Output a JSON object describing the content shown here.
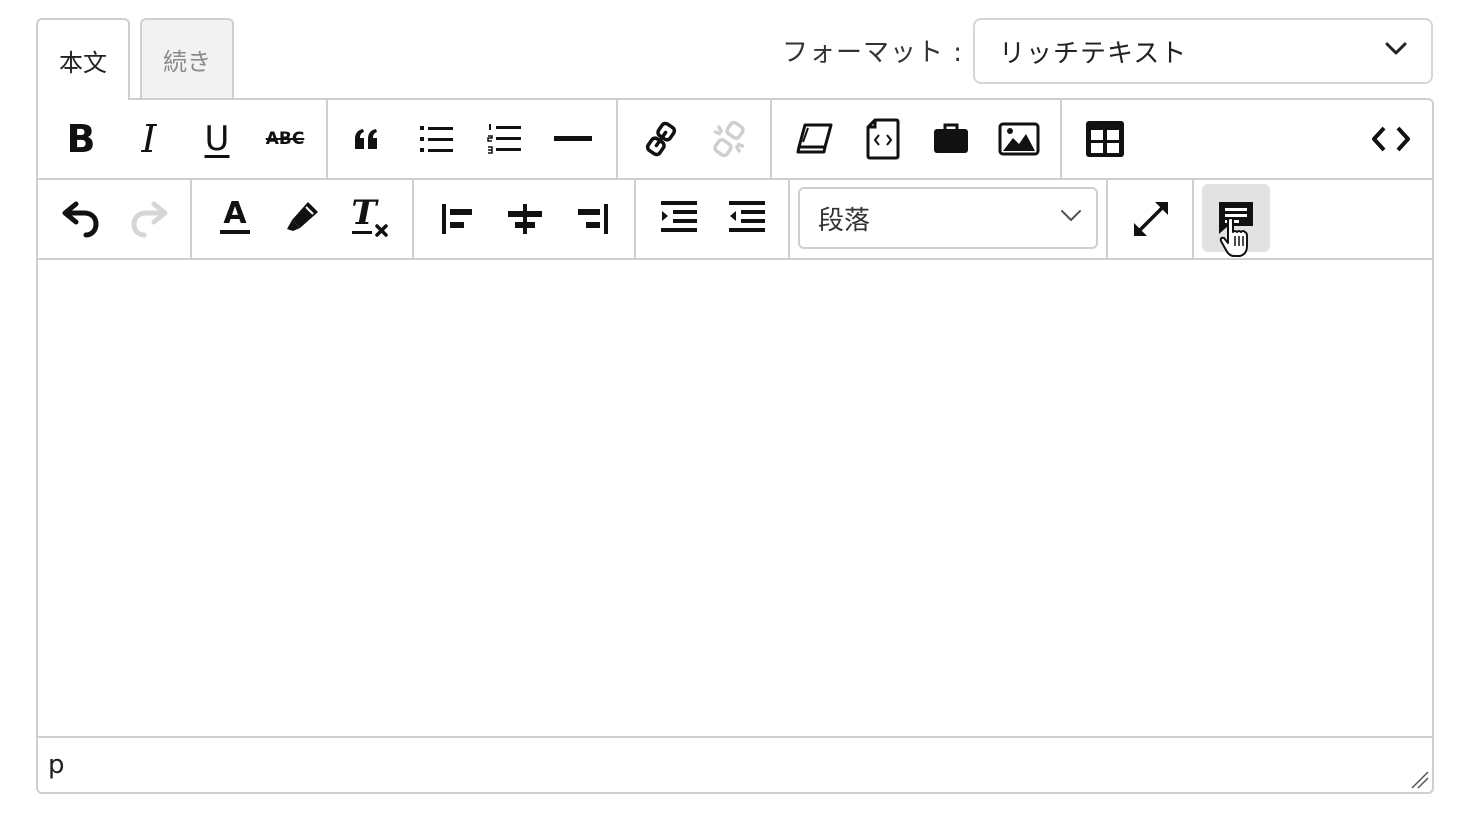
{
  "tabs": [
    {
      "label": "本文",
      "active": true
    },
    {
      "label": "続き",
      "active": false
    }
  ],
  "format": {
    "label": "フォーマット :",
    "selected": "リッチテキスト"
  },
  "toolbar": {
    "row1": [
      {
        "name": "bold-button",
        "icon": "bold-icon",
        "glyph": "B"
      },
      {
        "name": "italic-button",
        "icon": "italic-icon",
        "glyph": "I"
      },
      {
        "name": "underline-button",
        "icon": "underline-icon",
        "glyph": "U"
      },
      {
        "name": "strikethrough-button",
        "icon": "strikethrough-icon",
        "glyph": "ABC"
      },
      {
        "name": "blockquote-button",
        "icon": "quote-icon"
      },
      {
        "name": "bullet-list-button",
        "icon": "bullet-list-icon"
      },
      {
        "name": "numbered-list-button",
        "icon": "numbered-list-icon"
      },
      {
        "name": "horizontal-rule-button",
        "icon": "horizontal-rule-icon"
      },
      {
        "name": "link-button",
        "icon": "link-icon"
      },
      {
        "name": "unlink-button",
        "icon": "unlink-icon",
        "disabled": true
      },
      {
        "name": "template-button",
        "icon": "template-icon"
      },
      {
        "name": "code-file-button",
        "icon": "code-file-icon"
      },
      {
        "name": "media-button",
        "icon": "briefcase-icon"
      },
      {
        "name": "image-button",
        "icon": "image-icon"
      },
      {
        "name": "table-button",
        "icon": "table-icon"
      },
      {
        "name": "source-code-button",
        "icon": "code-icon"
      }
    ],
    "row2": [
      {
        "name": "undo-button",
        "icon": "undo-icon"
      },
      {
        "name": "redo-button",
        "icon": "redo-icon",
        "disabled": true
      },
      {
        "name": "text-color-button",
        "icon": "text-color-icon",
        "glyph": "A"
      },
      {
        "name": "highlight-button",
        "icon": "highlighter-icon"
      },
      {
        "name": "clear-format-button",
        "icon": "clear-format-icon",
        "glyph": "T"
      },
      {
        "name": "align-left-button",
        "icon": "align-left-icon"
      },
      {
        "name": "align-center-button",
        "icon": "align-center-icon"
      },
      {
        "name": "align-right-button",
        "icon": "align-right-icon"
      },
      {
        "name": "indent-button",
        "icon": "indent-icon"
      },
      {
        "name": "outdent-button",
        "icon": "outdent-icon"
      },
      {
        "name": "fullscreen-button",
        "icon": "expand-icon"
      },
      {
        "name": "comment-button",
        "icon": "comment-icon",
        "hovered": true
      }
    ],
    "paragraph_select": "段落"
  },
  "statusbar": {
    "path": "p"
  },
  "colors": {
    "border": "#cfcfcf",
    "icon": "#111111",
    "disabled_icon": "#cfcfcf",
    "hover_bg": "#e2e2e2",
    "inactive_tab_bg": "#f2f2f2"
  }
}
